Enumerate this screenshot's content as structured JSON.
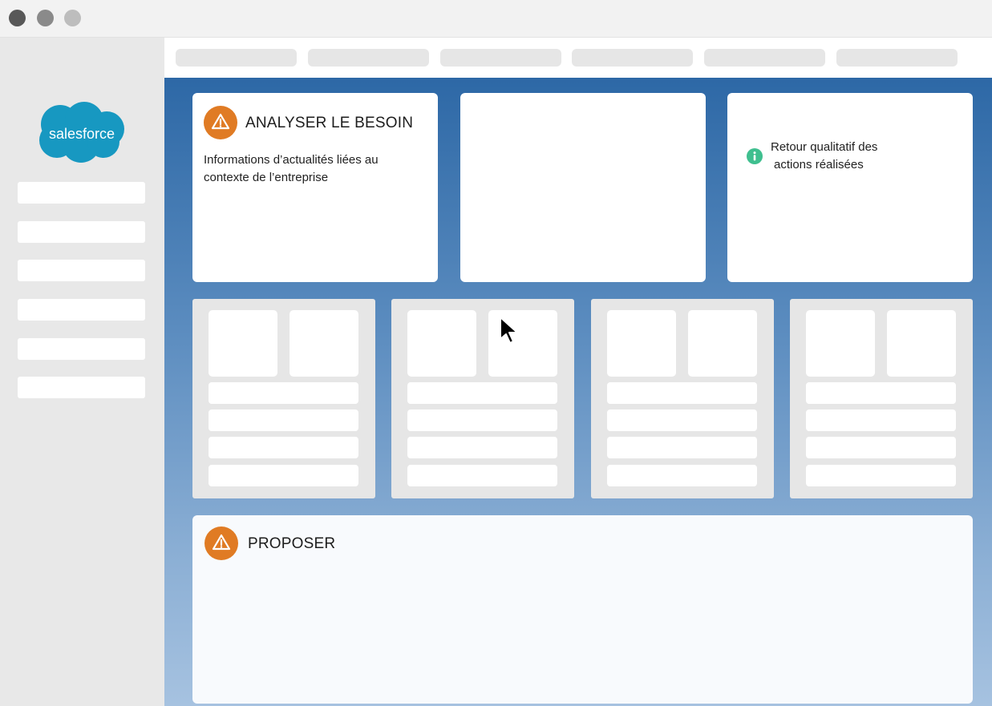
{
  "window": {
    "controls": [
      "close",
      "minimize",
      "maximize"
    ],
    "control_colors": [
      "#585858",
      "#8a8a8a",
      "#bdbdbd"
    ]
  },
  "sidebar": {
    "logo_text": "salesforce",
    "logo_color": "#1798c1",
    "item_count": 6
  },
  "topnav": {
    "tab_count": 6
  },
  "cards": {
    "analyse": {
      "title": "ANALYSER LE BESOIN",
      "text": "Informations d’actualités liées au contexte de l’entreprise",
      "icon": "warning-icon"
    },
    "blank": {},
    "feedback": {
      "text_line1": "Retour qualitatif des",
      "text_line2": "actions réalisées",
      "icon": "info-icon"
    },
    "proposer": {
      "title": "PROPOSER",
      "icon": "warning-icon"
    }
  },
  "panels": {
    "count": 4,
    "tiles_per_panel": 2,
    "rows_per_panel": 4
  },
  "colors": {
    "warning": "#e07b24",
    "info": "#3fbf8f",
    "background_top": "#2d68a6",
    "background_bottom": "#a6c2e0"
  },
  "cursor": "arrow-cursor-icon"
}
